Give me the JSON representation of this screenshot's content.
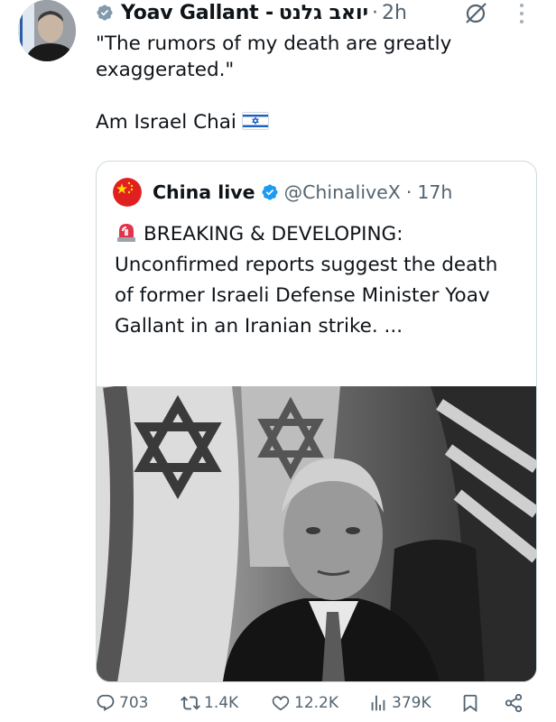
{
  "tweet": {
    "author_name": "Yoav Gallant -",
    "author_hebrew": "יואב גלנט",
    "separator": "·",
    "time": "2h",
    "text_line1": "\"The rumors of my death are greatly exaggerated.\"",
    "text_line2": "Am Israel Chai",
    "flag_emoji": "israel-flag"
  },
  "quote": {
    "name": "China live",
    "handle": "@ChinaliveX",
    "separator": "·",
    "time": "17h",
    "siren_emoji": "rotating-light",
    "text": "BREAKING & DEVELOPING: Unconfirmed reports suggest the death of former Israeli Defense Minister Yoav Gallant in an Iranian strike. ..."
  },
  "actions": {
    "replies": "703",
    "reposts": "1.4K",
    "likes": "12.2K",
    "views": "379K"
  },
  "colors": {
    "text": "#0f1419",
    "secondary": "#536471",
    "verified_blue": "#1d9bf0",
    "verified_gray": "#829aab",
    "border": "#cfd9de"
  },
  "icons": [
    "verified-gray-badge",
    "grok-icon",
    "more-icon",
    "verified-blue-badge",
    "reply-icon",
    "repost-icon",
    "like-icon",
    "views-icon",
    "bookmark-icon",
    "share-icon"
  ]
}
